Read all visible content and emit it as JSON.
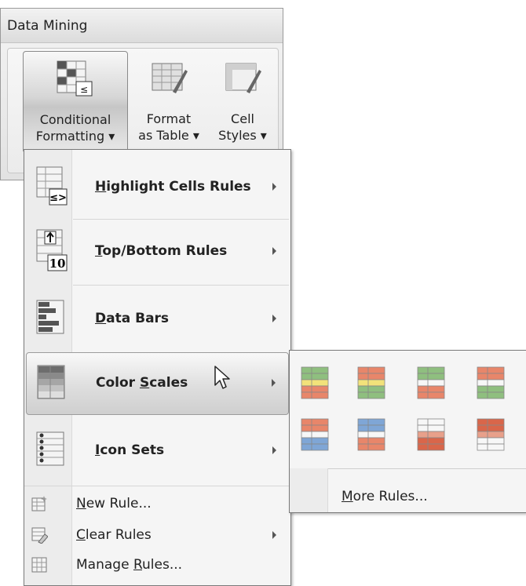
{
  "ribbon": {
    "tab_title": "Data Mining",
    "buttons": [
      {
        "line1": "Conditional",
        "line2": "Formatting ▾"
      },
      {
        "line1": "Format",
        "line2": "as Table ▾"
      },
      {
        "line1": "Cell",
        "line2": "Styles ▾"
      }
    ]
  },
  "menu": {
    "items": [
      {
        "label": "Highlight Cells Rules",
        "accel": "H"
      },
      {
        "label": "Top/Bottom Rules",
        "accel": "T"
      },
      {
        "label": "Data Bars",
        "accel": "D"
      },
      {
        "label": "Color Scales",
        "accel": "S",
        "state": "hover"
      },
      {
        "label": "Icon Sets",
        "accel": "I"
      }
    ],
    "small_items": [
      {
        "label": "New Rule...",
        "accel": "N"
      },
      {
        "label": "Clear Rules",
        "accel": "C"
      },
      {
        "label": "Manage Rules...",
        "accel": "R"
      }
    ]
  },
  "submenu": {
    "more_label": "More Rules...",
    "swatches": [
      [
        "#8fbf7f",
        "#f2e27a",
        "#e8866a"
      ],
      [
        "#e8866a",
        "#f2e27a",
        "#8fbf7f"
      ],
      [
        "#8fbf7f",
        "#f7f7f7",
        "#e8866a"
      ],
      [
        "#e8866a",
        "#f7f7f7",
        "#8fbf7f"
      ],
      [
        "#e8866a",
        "#f7f7f7",
        "#7fa6d6"
      ],
      [
        "#7fa6d6",
        "#f7f7f7",
        "#e8866a"
      ],
      [
        "#f7f7f7",
        "#e8a08a",
        "#d9664a"
      ],
      [
        "#d9664a",
        "#e8a08a",
        "#f7f7f7"
      ]
    ]
  }
}
